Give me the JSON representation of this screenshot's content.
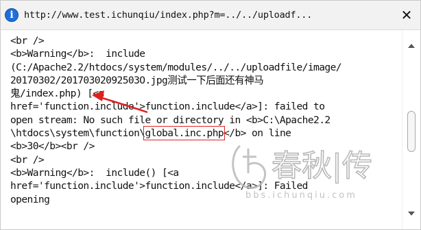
{
  "window": {
    "url": "http://www.test.ichunqiu/index.php?m=../../uploadf...",
    "close_label": "✕"
  },
  "content": {
    "lines": [
      "<br />",
      "<b>Warning</b>:  include",
      "(C:/Apache2.2/htdocs/system/modules/../../uploadfile/image/",
      "20170302/20170302092503O.jpg测试一下后面还有神马",
      "鬼/index.php) [<a",
      "href='function.include'>function.include</a>]: failed to",
      "open stream: No such file or directory in <b>C:\\Apache2.2",
      "\\htdocs\\system\\function\\global.inc.php</b> on line",
      "<b>30</b><br />",
      "<br />",
      "<b>Warning</b>:  include() [<a",
      "href='function.include'>function.include</a>]: Failed",
      "opening"
    ],
    "line8_prefix": "\\htdocs\\system\\function\\",
    "highlight": "global.inc.php",
    "line8_suffix": "</b> on line"
  },
  "watermark": {
    "brand": "春秋|传",
    "domain": "bbs.ichunqiu.com"
  },
  "colors": {
    "annotation": "#e02020",
    "info_icon": "#1e6fd9",
    "watermark": "#b9b9b9"
  }
}
